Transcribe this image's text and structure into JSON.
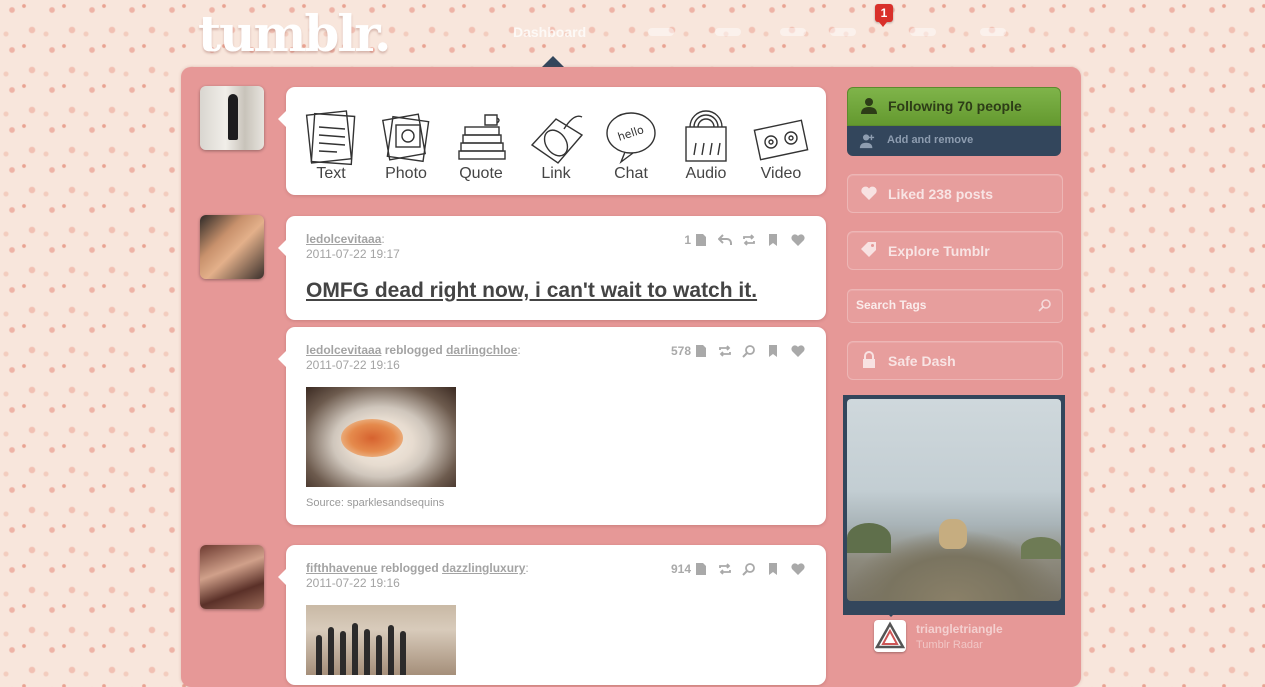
{
  "brand": {
    "logo": "tumblr."
  },
  "nav": {
    "active": "Dashboard",
    "notification_count": "1"
  },
  "post_types": [
    {
      "label": "Text",
      "icon": "text-icon"
    },
    {
      "label": "Photo",
      "icon": "photo-icon"
    },
    {
      "label": "Quote",
      "icon": "quote-icon"
    },
    {
      "label": "Link",
      "icon": "link-icon"
    },
    {
      "label": "Chat",
      "icon": "chat-icon",
      "bubble_text": "hello"
    },
    {
      "label": "Audio",
      "icon": "audio-icon"
    },
    {
      "label": "Video",
      "icon": "video-icon"
    }
  ],
  "posts": [
    {
      "author": "ledolcevitaaa",
      "author_suffix": ":",
      "date": "2011-07-22 19:17",
      "notes": "1",
      "title": "OMFG dead right now, i can't wait to watch it."
    },
    {
      "author": "ledolcevitaaa",
      "reblogged_label": "reblogged",
      "source_author": "darlingchloe",
      "author_suffix": ":",
      "date": "2011-07-22 19:16",
      "notes": "578",
      "source": "Source: sparklesandsequins"
    },
    {
      "author": "fifthhavenue",
      "reblogged_label": "reblogged",
      "source_author": "dazzlingluxury",
      "author_suffix": ":",
      "date": "2011-07-22 19:16",
      "notes": "914"
    }
  ],
  "sidebar": {
    "following": "Following 70 people",
    "add_remove": "Add and remove",
    "liked": "Liked 238 posts",
    "explore": "Explore Tumblr",
    "search_placeholder": "Search Tags",
    "safe_dash": "Safe Dash",
    "radar_user": "triangletriangle",
    "radar_sub": "Tumblr Radar"
  },
  "colors": {
    "panel": "#e69897",
    "nav_dark": "#33465c",
    "follow_green": "#7fb44a",
    "badge_red": "#d9302a"
  }
}
